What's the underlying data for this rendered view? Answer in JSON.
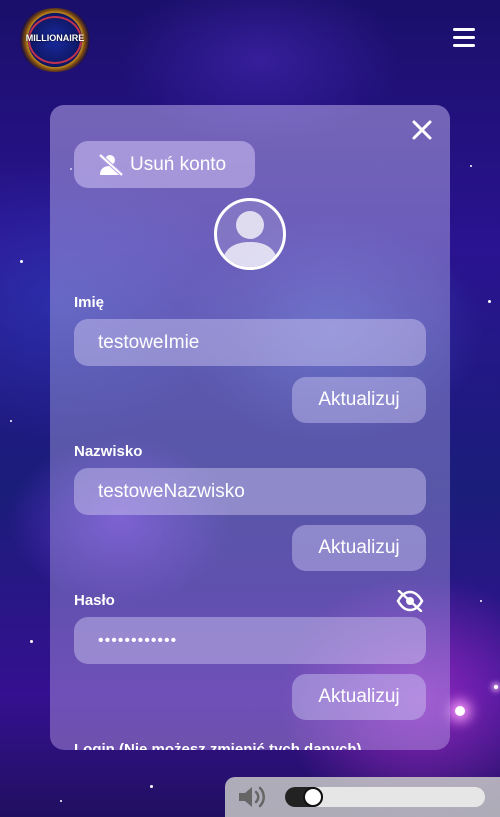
{
  "app": {
    "logo_text": "MILLIONAIRE"
  },
  "header": {
    "menu_icon": "hamburger-menu-icon"
  },
  "profile": {
    "close_icon": "close-icon",
    "delete_account": {
      "label": "Usuń konto",
      "icon": "user-slash-icon"
    },
    "avatar_icon": "user-avatar-icon",
    "fields": [
      {
        "label": "Imię",
        "value": "testoweImie",
        "button": "Aktualizuj"
      },
      {
        "label": "Nazwisko",
        "value": "testoweNazwisko",
        "button": "Aktualizuj"
      },
      {
        "label": "Hasło",
        "value": "••••••••••••",
        "button": "Aktualizuj",
        "toggle_icon": "eye-slash-icon"
      }
    ],
    "login_label": "Login (Nie możesz zmienić tych danych)"
  },
  "audio": {
    "icon": "speaker-volume-icon",
    "volume": 0.1
  }
}
